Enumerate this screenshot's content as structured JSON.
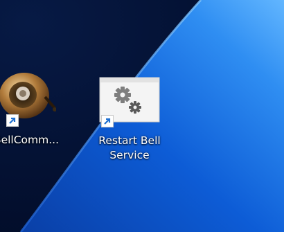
{
  "desktop": {
    "background_colors": {
      "dark": "#041438",
      "blue": "#0a56c8",
      "light": "#3f9cf6"
    },
    "icons": [
      {
        "label": "BellComm...",
        "icon": "bell-app-icon",
        "shortcut": true
      },
      {
        "label": "Restart Bell\nService",
        "icon": "settings-gears-window-icon",
        "shortcut": true
      }
    ]
  }
}
